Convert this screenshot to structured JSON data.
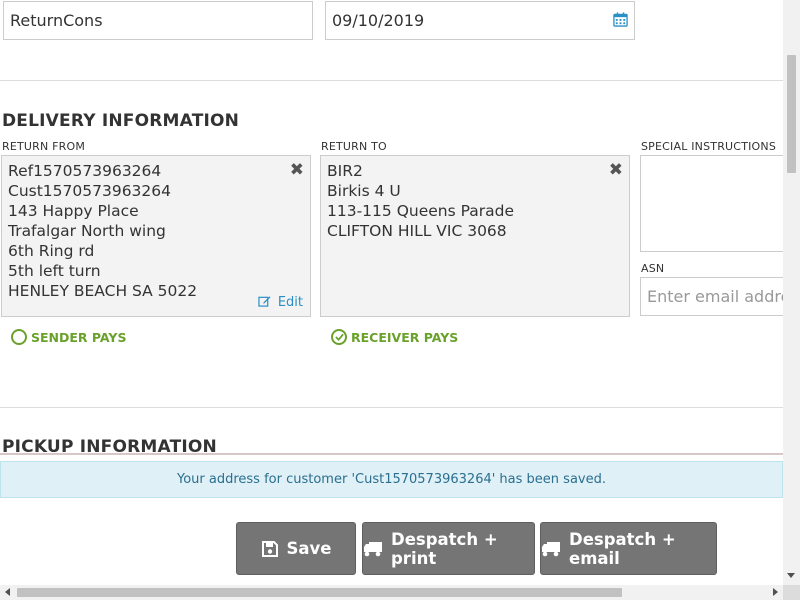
{
  "top": {
    "reference_value": "ReturnCons",
    "date_value": "09/10/2019"
  },
  "delivery": {
    "title": "DELIVERY INFORMATION",
    "return_from": {
      "label": "RETURN FROM",
      "lines": [
        "Ref1570573963264",
        "Cust1570573963264",
        "143 Happy Place",
        "Trafalgar North wing",
        "6th Ring rd",
        "5th left turn",
        "HENLEY BEACH SA 5022"
      ],
      "remove_glyph": "✖",
      "edit_label": "Edit"
    },
    "return_to": {
      "label": "RETURN TO",
      "lines": [
        "BIR2",
        "Birkis 4 U",
        "113-115 Queens Parade",
        "CLIFTON HILL VIC 3068"
      ],
      "remove_glyph": "✖"
    },
    "special_instructions_label": "SPECIAL INSTRUCTIONS",
    "asn_label": "ASN",
    "asn_placeholder": "Enter email address",
    "sender_pays": "SENDER PAYS",
    "receiver_pays": "RECEIVER PAYS",
    "payment_selected": "receiver"
  },
  "pickup": {
    "title": "PICKUP INFORMATION"
  },
  "alert": {
    "message": "Your address for customer 'Cust1570573963264' has been saved."
  },
  "actions": {
    "save": "Save",
    "despatch_print": "Despatch + print",
    "despatch_email": "Despatch + email"
  },
  "icons": {
    "calendar": "calendar-icon",
    "remove": "times-icon",
    "edit": "edit-icon",
    "save": "floppy-disk-icon",
    "truck": "truck-icon",
    "check": "check-circle-icon"
  },
  "colors": {
    "accent_green": "#6aa12b",
    "link_blue": "#2a8fc7",
    "button_gray": "#757575",
    "alert_bg": "#dff0f6",
    "alert_text": "#2a6f8f"
  }
}
